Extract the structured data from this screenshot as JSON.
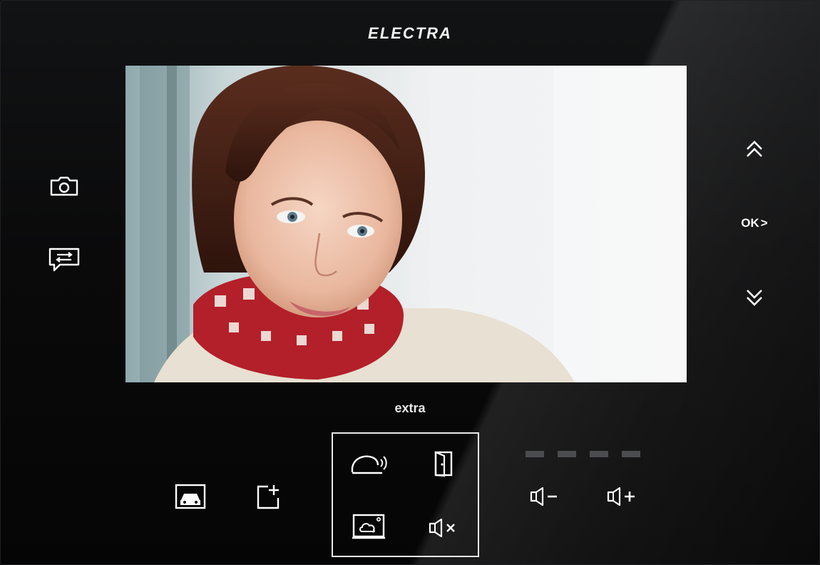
{
  "device": {
    "brand": "ELECTRA",
    "model_label": "extra"
  },
  "icons": {
    "left": [
      "camera-icon",
      "message-icon"
    ],
    "right": [
      "up-icon",
      "ok-button",
      "down-icon"
    ],
    "bottom": [
      "garage-icon",
      "add-icon",
      "unlock-gate-icon",
      "door-icon",
      "monitor-icon",
      "mute-icon",
      "volume-down-icon",
      "volume-up-icon"
    ]
  },
  "controls": {
    "ok_label": "OK",
    "ok_arrow": ">"
  },
  "volume": {
    "levels_total": 4,
    "levels_active": 0
  },
  "colors": {
    "panel": "#0b0c0d",
    "icon": "#ffffff",
    "led": "#4a4c4f"
  }
}
